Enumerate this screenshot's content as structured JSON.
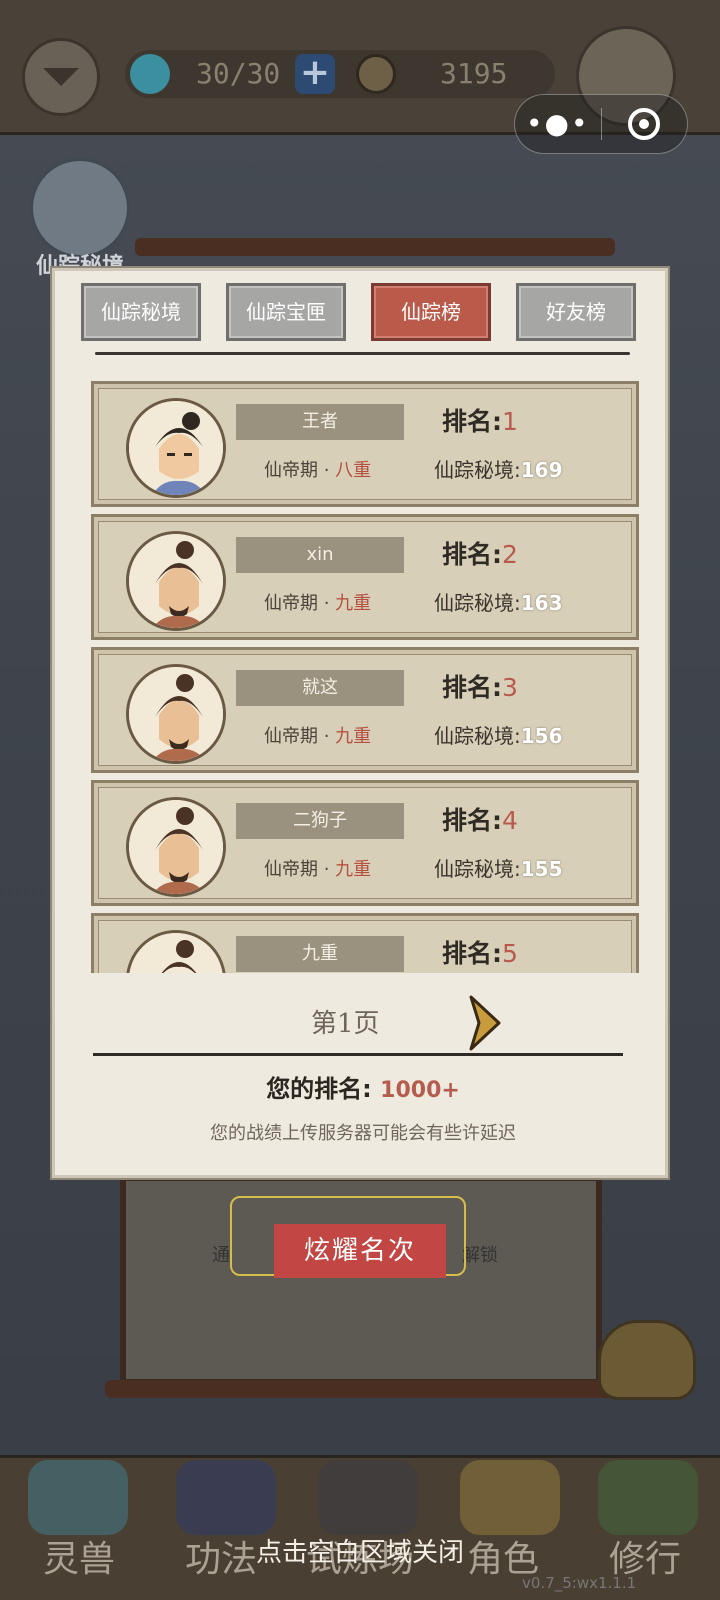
{
  "hud": {
    "stamina": "30/30",
    "coins": "3195",
    "stamina_icon": "blue-drop-icon",
    "coin_icon": "copper-coin-icon",
    "plus_label": "+"
  },
  "side": {
    "label": "仙踪秘境"
  },
  "tabs": [
    {
      "label": "仙踪秘境",
      "active": false
    },
    {
      "label": "仙踪宝匣",
      "active": false
    },
    {
      "label": "仙踪榜",
      "active": true
    },
    {
      "label": "好友榜",
      "active": false
    }
  ],
  "leaderboard": [
    {
      "name": "王者",
      "realm": "仙帝期",
      "level": "八重",
      "rank_label": "排名:",
      "rank": "1",
      "score_label": "仙踪秘境:",
      "score": "169"
    },
    {
      "name": "xin",
      "realm": "仙帝期",
      "level": "九重",
      "rank_label": "排名:",
      "rank": "2",
      "score_label": "仙踪秘境:",
      "score": "163"
    },
    {
      "name": "就这",
      "realm": "仙帝期",
      "level": "九重",
      "rank_label": "排名:",
      "rank": "3",
      "score_label": "仙踪秘境:",
      "score": "156"
    },
    {
      "name": "二狗子",
      "realm": "仙帝期",
      "level": "九重",
      "rank_label": "排名:",
      "rank": "4",
      "score_label": "仙踪秘境:",
      "score": "155"
    },
    {
      "name": "九重",
      "realm": "",
      "level": "",
      "rank_label": "排名:",
      "rank": "5",
      "score_label": "",
      "score": ""
    }
  ],
  "realm_sep": " · ",
  "pager": {
    "label": "第1页"
  },
  "my_rank": {
    "label": "您的排名: ",
    "value": "1000+"
  },
  "notice": "您的战绩上传服务器可能会有些许延迟",
  "showoff": {
    "label": "炫耀名次"
  },
  "under_texts": {
    "left": "通",
    "right": "解锁"
  },
  "bottom_nav": [
    {
      "label": "灵兽"
    },
    {
      "label": "功法"
    },
    {
      "label": "试炼场"
    },
    {
      "label": "角色"
    },
    {
      "label": "修行"
    }
  ],
  "close_hint": "点击空白区域关闭",
  "version": "v0.7_5:wx1.1.1",
  "colors": {
    "active_tab": "#b95a4b",
    "rank_number": "#b85a4e",
    "level_text": "#b5503f",
    "showoff_button": "#c24744"
  }
}
